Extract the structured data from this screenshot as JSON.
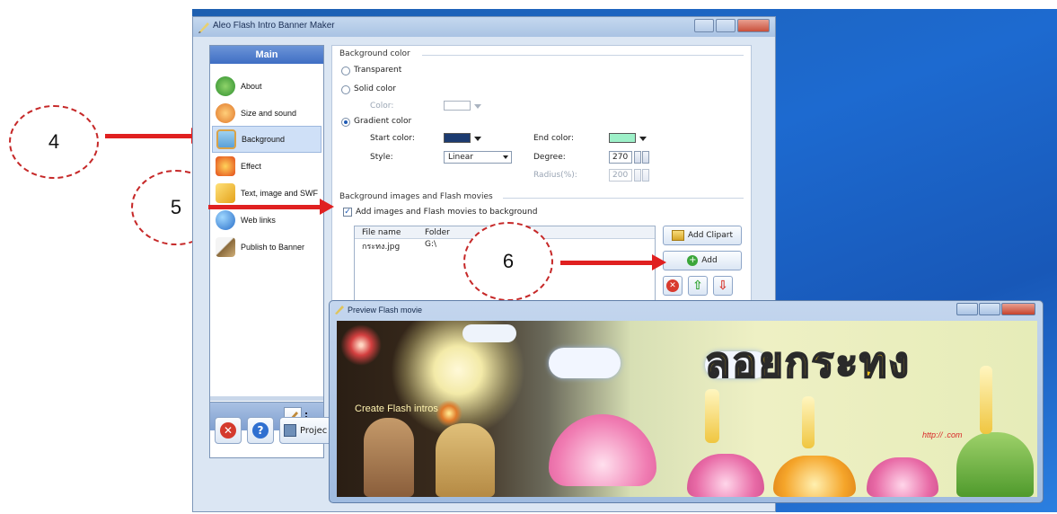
{
  "callouts": {
    "c4": "4",
    "c5": "5",
    "c6": "6"
  },
  "colors": {
    "callout_border": "#c62828",
    "arrow": "#e02020",
    "start_color": "#1c3b70",
    "end_color": "#9df0c8",
    "solid_color": "#ffffff"
  },
  "app": {
    "title": "Aleo Flash Intro Banner Maker"
  },
  "sidebar": {
    "header": "Main",
    "items": [
      {
        "label": "About",
        "icon": "home-icon"
      },
      {
        "label": "Size and sound",
        "icon": "size-sound-icon"
      },
      {
        "label": "Background",
        "icon": "background-icon",
        "selected": true
      },
      {
        "label": "Effect",
        "icon": "effect-icon"
      },
      {
        "label": "Text, image and SWF",
        "icon": "text-image-icon"
      },
      {
        "label": "Web links",
        "icon": "globe-icon"
      },
      {
        "label": "Publish to Banner",
        "icon": "brush-icon"
      }
    ]
  },
  "toolbar": {
    "project_label": "Projec"
  },
  "background_color": {
    "group_title": "Background color",
    "transparent": "Transparent",
    "solid": "Solid color",
    "solid_color_label": "Color:",
    "gradient": "Gradient color",
    "start_color_label": "Start color:",
    "end_color_label": "End color:",
    "style_label": "Style:",
    "style_value": "Linear",
    "degree_label": "Degree:",
    "degree_value": "270",
    "radius_label": "Radius(%):",
    "radius_value": "200",
    "selected_mode": "gradient"
  },
  "bg_images": {
    "group_title": "Background images and Flash movies",
    "checkbox_label": "Add images and Flash movies to background",
    "checked": true,
    "columns": [
      "File name",
      "Folder"
    ],
    "rows": [
      {
        "file": "กระทง.jpg",
        "folder": "G:\\"
      }
    ],
    "add_clipart": "Add Clipart",
    "add": "Add"
  },
  "preview": {
    "title": "Preview Flash movie",
    "banner_text": "ลอยกระทง",
    "intro_text": "Create Flash intros",
    "url_text": "http://                 .com"
  }
}
